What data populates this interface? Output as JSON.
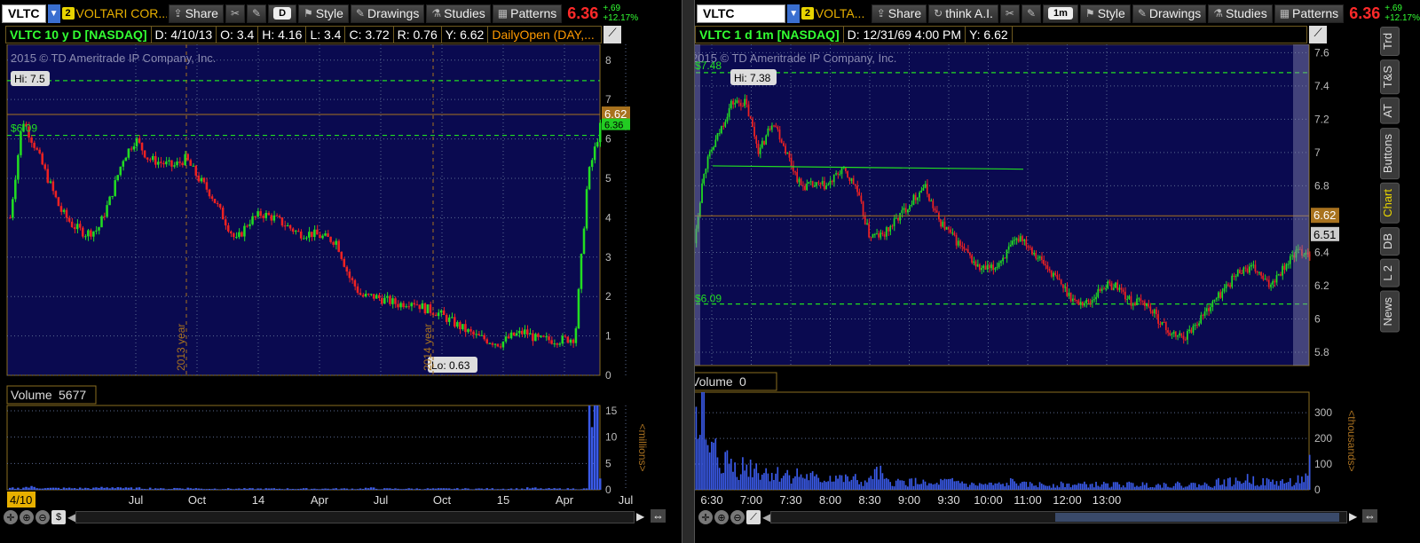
{
  "left": {
    "symbol": "VLTC",
    "alert_badge": "2",
    "company": "VOLTARI COR...",
    "buttons": {
      "share": "Share",
      "aggregation": "D",
      "style": "Style",
      "drawings": "Drawings",
      "studies": "Studies",
      "patterns": "Patterns"
    },
    "last": "6.36",
    "change": "+.69",
    "change_pct": "+12.17%",
    "status": {
      "title": "VLTC 10 y D [NASDAQ]",
      "date": "D: 4/10/13",
      "open": "O: 3.4",
      "high": "H: 4.16",
      "low": "L: 3.4",
      "close": "C: 3.72",
      "range": "R: 0.76",
      "y": "Y: 6.62",
      "study": "DailyOpen (DAY,..."
    },
    "copyright": "2015 © TD Ameritrade IP Company, Inc.",
    "hi_label": "Hi: 7.5",
    "lo_label": "Lo: 0.63",
    "price_label_hidden": "7.48",
    "open_label": "$6.09",
    "year_labels": [
      "2013 year",
      "2014 year"
    ],
    "price_markers": {
      "primary": "6.62",
      "secondary": "6.36"
    },
    "volume_label": "Volume",
    "volume_value": "5677",
    "volume_unit": "<millions>",
    "date_marker": "4/10",
    "chart_data": {
      "type": "candlestick",
      "y_ticks": [
        0,
        1,
        2,
        3,
        4,
        5,
        6,
        7,
        8
      ],
      "ylim": [
        0,
        8.4
      ],
      "x_ticks": [
        "Jul",
        "Oct",
        "14",
        "Apr",
        "Jul",
        "Oct",
        "15",
        "Apr",
        "Jul"
      ],
      "volume_ticks": [
        0,
        5,
        10,
        15
      ],
      "volume_ylim": [
        0,
        16
      ],
      "hlines": [
        7.48,
        6.09
      ],
      "close_path": [
        4.0,
        6.5,
        5.8,
        5.0,
        4.2,
        3.8,
        3.6,
        3.7,
        4.5,
        5.5,
        6.0,
        5.5,
        5.4,
        5.3,
        5.5,
        5.0,
        4.6,
        4.0,
        3.4,
        3.9,
        4.1,
        4.0,
        3.8,
        3.6,
        3.6,
        3.5,
        3.4,
        2.5,
        2.0,
        2.0,
        1.9,
        1.8,
        1.9,
        1.7,
        1.6,
        1.4,
        1.2,
        1.0,
        0.9,
        0.8,
        1.0,
        1.1,
        0.9,
        0.9,
        0.9,
        0.95,
        5.0,
        6.3
      ],
      "volume_path": [
        0.3,
        0.5,
        0.4,
        0.3,
        0.3,
        0.3,
        0.3,
        0.4,
        0.5,
        0.3,
        0.3,
        0.3,
        0.2,
        0.3,
        0.3,
        0.2,
        0.2,
        0.2,
        0.2,
        0.2,
        0.2,
        0.2,
        0.2,
        0.2,
        0.2,
        0.2,
        0.2,
        0.2,
        0.3,
        0.2,
        0.2,
        0.2,
        0.2,
        0.2,
        0.2,
        0.2,
        0.2,
        0.2,
        0.2,
        0.2,
        0.2,
        0.3,
        0.2,
        0.2,
        0.2,
        0.2,
        14.5,
        3.0
      ]
    }
  },
  "right": {
    "symbol": "VLTC",
    "alert_badge": "2",
    "company": "VOLTA...",
    "buttons": {
      "share": "Share",
      "think": "think A.I.",
      "aggregation": "1m",
      "style": "Style",
      "drawings": "Drawings",
      "studies": "Studies",
      "patterns": "Patterns"
    },
    "last": "6.36",
    "change": "+.69",
    "change_pct": "+12.17%",
    "status": {
      "title": "VLTC 1 d 1m [NASDAQ]",
      "date": "D: 12/31/69 4:00 PM",
      "y": "Y: 6.62"
    },
    "copyright": "2015 © TD Ameritrade IP Company, Inc.",
    "hi_label": "Hi: 7.38",
    "price_label_top": "$7.48",
    "open_label": "$6.09",
    "price_markers": {
      "primary": "6.62",
      "secondary": "6.51"
    },
    "volume_label": "Volume",
    "volume_value": "0",
    "volume_unit": "<thousands>",
    "chart_data": {
      "type": "candlestick",
      "y_ticks": [
        5.8,
        6.0,
        6.2,
        6.4,
        6.6,
        6.8,
        7.0,
        7.2,
        7.4,
        7.6
      ],
      "ylim": [
        5.72,
        7.65
      ],
      "x_ticks": [
        "6:30",
        "7:00",
        "7:30",
        "8:00",
        "8:30",
        "9:00",
        "9:30",
        "10:00",
        "11:00",
        "12:00",
        "13:00"
      ],
      "volume_ticks": [
        0,
        100,
        200,
        300
      ],
      "volume_ylim": [
        0,
        380
      ],
      "hlines": [
        7.48,
        6.09
      ],
      "trendline": [
        6.92,
        6.9
      ],
      "close_path": [
        6.3,
        6.9,
        7.1,
        7.3,
        7.3,
        7.0,
        7.2,
        7.0,
        6.8,
        6.8,
        6.8,
        6.9,
        6.8,
        6.5,
        6.5,
        6.6,
        6.7,
        6.8,
        6.6,
        6.5,
        6.4,
        6.3,
        6.3,
        6.4,
        6.5,
        6.4,
        6.3,
        6.2,
        6.1,
        6.1,
        6.2,
        6.2,
        6.1,
        6.1,
        6.0,
        5.9,
        5.9,
        6.0,
        6.1,
        6.2,
        6.3,
        6.3,
        6.2,
        6.3,
        6.4,
        6.4
      ],
      "volume_path": [
        360,
        140,
        110,
        90,
        90,
        70,
        60,
        60,
        50,
        40,
        50,
        40,
        30,
        60,
        30,
        30,
        30,
        20,
        30,
        30,
        20,
        20,
        20,
        30,
        20,
        20,
        20,
        20,
        20,
        20,
        20,
        20,
        20,
        20,
        20,
        20,
        20,
        20,
        30,
        30,
        40,
        30,
        30,
        30,
        40,
        100
      ]
    }
  },
  "side_tabs": [
    "Trd",
    "T&S",
    "AT",
    "Buttons",
    "Chart",
    "DB",
    "L 2",
    "News"
  ],
  "colors": {
    "grid": "#5a6a90",
    "bg": "#0a0a50",
    "border": "#8a6e20",
    "up": "#22dd22",
    "down": "#ee2222",
    "hline": "#22dd22",
    "volume": "#3a5ae8",
    "marker": "#a8721e"
  }
}
